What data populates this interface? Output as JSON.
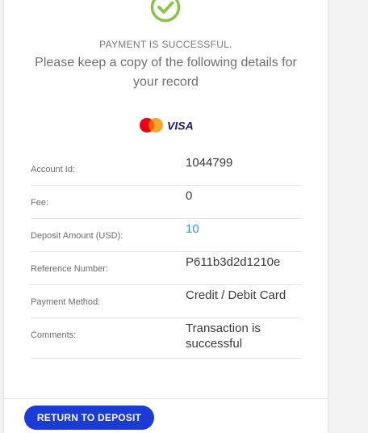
{
  "status": {
    "title": "PAYMENT IS SUCCESSFUL.",
    "subtitle": "Please keep a copy of the following details for your record"
  },
  "card_logos": {
    "visa_text": "VISA",
    "mastercard_colors": [
      "#eb001b",
      "#f79e1b"
    ],
    "visa_color": "#1a1f71"
  },
  "details": [
    {
      "label": "Account Id:",
      "value": "1044799"
    },
    {
      "label": "Fee:",
      "value": "0"
    },
    {
      "label": "Deposit Amount (USD):",
      "value": "10"
    },
    {
      "label": "Reference Number:",
      "value": "P611b3d2d1210e"
    },
    {
      "label": "Payment Method:",
      "value": "Credit / Debit Card"
    },
    {
      "label": "Comments:",
      "value": "Transaction is successful"
    }
  ],
  "actions": {
    "return_label": "RETURN TO DEPOSIT"
  },
  "colors": {
    "success": "#8bc34a",
    "link": "#2196f3",
    "primary_button": "#1a3bd6"
  }
}
